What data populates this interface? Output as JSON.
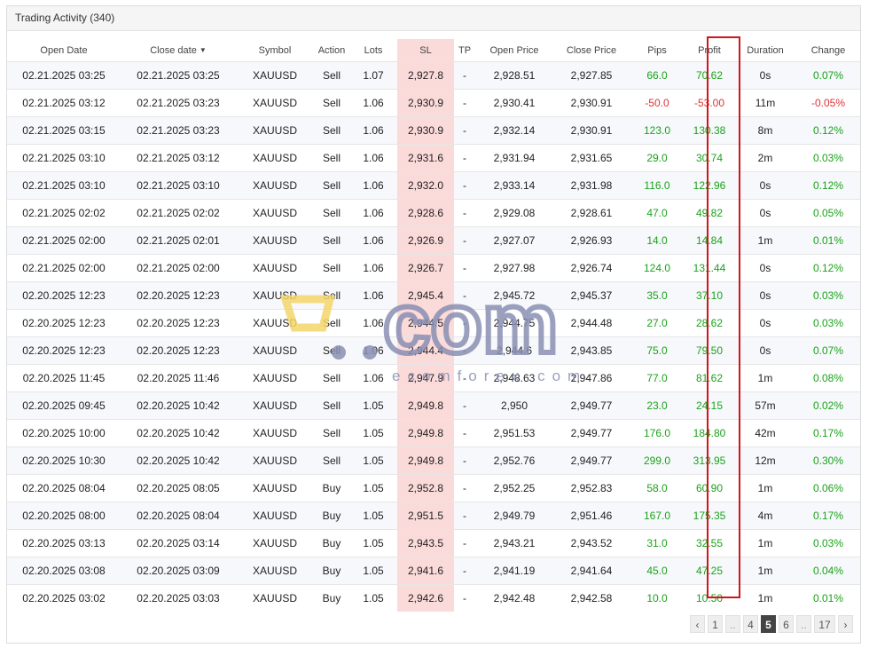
{
  "panel": {
    "title": "Trading Activity (340)"
  },
  "table": {
    "headers": {
      "open_date": "Open Date",
      "close_date": "Close date",
      "symbol": "Symbol",
      "action": "Action",
      "lots": "Lots",
      "sl": "SL",
      "tp": "TP",
      "open_price": "Open Price",
      "close_price": "Close Price",
      "pips": "Pips",
      "profit": "Profit",
      "duration": "Duration",
      "change": "Change"
    },
    "sort_indicator": "▼",
    "rows": [
      {
        "open": "02.21.2025 03:25",
        "close": "02.21.2025 03:25",
        "symbol": "XAUUSD",
        "action": "Sell",
        "lots": "1.07",
        "sl": "2,927.8",
        "tp": "-",
        "open_price": "2,928.51",
        "close_price": "2,927.85",
        "pips": "66.0",
        "profit": "70.62",
        "duration": "0s",
        "change": "0.07%",
        "sign": "pos"
      },
      {
        "open": "02.21.2025 03:12",
        "close": "02.21.2025 03:23",
        "symbol": "XAUUSD",
        "action": "Sell",
        "lots": "1.06",
        "sl": "2,930.9",
        "tp": "-",
        "open_price": "2,930.41",
        "close_price": "2,930.91",
        "pips": "-50.0",
        "profit": "-53.00",
        "duration": "11m",
        "change": "-0.05%",
        "sign": "neg"
      },
      {
        "open": "02.21.2025 03:15",
        "close": "02.21.2025 03:23",
        "symbol": "XAUUSD",
        "action": "Sell",
        "lots": "1.06",
        "sl": "2,930.9",
        "tp": "-",
        "open_price": "2,932.14",
        "close_price": "2,930.91",
        "pips": "123.0",
        "profit": "130.38",
        "duration": "8m",
        "change": "0.12%",
        "sign": "pos"
      },
      {
        "open": "02.21.2025 03:10",
        "close": "02.21.2025 03:12",
        "symbol": "XAUUSD",
        "action": "Sell",
        "lots": "1.06",
        "sl": "2,931.6",
        "tp": "-",
        "open_price": "2,931.94",
        "close_price": "2,931.65",
        "pips": "29.0",
        "profit": "30.74",
        "duration": "2m",
        "change": "0.03%",
        "sign": "pos"
      },
      {
        "open": "02.21.2025 03:10",
        "close": "02.21.2025 03:10",
        "symbol": "XAUUSD",
        "action": "Sell",
        "lots": "1.06",
        "sl": "2,932.0",
        "tp": "-",
        "open_price": "2,933.14",
        "close_price": "2,931.98",
        "pips": "116.0",
        "profit": "122.96",
        "duration": "0s",
        "change": "0.12%",
        "sign": "pos"
      },
      {
        "open": "02.21.2025 02:02",
        "close": "02.21.2025 02:02",
        "symbol": "XAUUSD",
        "action": "Sell",
        "lots": "1.06",
        "sl": "2,928.6",
        "tp": "-",
        "open_price": "2,929.08",
        "close_price": "2,928.61",
        "pips": "47.0",
        "profit": "49.82",
        "duration": "0s",
        "change": "0.05%",
        "sign": "pos"
      },
      {
        "open": "02.21.2025 02:00",
        "close": "02.21.2025 02:01",
        "symbol": "XAUUSD",
        "action": "Sell",
        "lots": "1.06",
        "sl": "2,926.9",
        "tp": "-",
        "open_price": "2,927.07",
        "close_price": "2,926.93",
        "pips": "14.0",
        "profit": "14.84",
        "duration": "1m",
        "change": "0.01%",
        "sign": "pos"
      },
      {
        "open": "02.21.2025 02:00",
        "close": "02.21.2025 02:00",
        "symbol": "XAUUSD",
        "action": "Sell",
        "lots": "1.06",
        "sl": "2,926.7",
        "tp": "-",
        "open_price": "2,927.98",
        "close_price": "2,926.74",
        "pips": "124.0",
        "profit": "131.44",
        "duration": "0s",
        "change": "0.12%",
        "sign": "pos"
      },
      {
        "open": "02.20.2025 12:23",
        "close": "02.20.2025 12:23",
        "symbol": "XAUUSD",
        "action": "Sell",
        "lots": "1.06",
        "sl": "2,945.4",
        "tp": "-",
        "open_price": "2,945.72",
        "close_price": "2,945.37",
        "pips": "35.0",
        "profit": "37.10",
        "duration": "0s",
        "change": "0.03%",
        "sign": "pos"
      },
      {
        "open": "02.20.2025 12:23",
        "close": "02.20.2025 12:23",
        "symbol": "XAUUSD",
        "action": "Sell",
        "lots": "1.06",
        "sl": "2,944.5",
        "tp": "-",
        "open_price": "2,944.75",
        "close_price": "2,944.48",
        "pips": "27.0",
        "profit": "28.62",
        "duration": "0s",
        "change": "0.03%",
        "sign": "pos"
      },
      {
        "open": "02.20.2025 12:23",
        "close": "02.20.2025 12:23",
        "symbol": "XAUUSD",
        "action": "Sell",
        "lots": "1.06",
        "sl": "2,944.4",
        "tp": "-",
        "open_price": "2,944.6",
        "close_price": "2,943.85",
        "pips": "75.0",
        "profit": "79.50",
        "duration": "0s",
        "change": "0.07%",
        "sign": "pos"
      },
      {
        "open": "02.20.2025 11:45",
        "close": "02.20.2025 11:46",
        "symbol": "XAUUSD",
        "action": "Sell",
        "lots": "1.06",
        "sl": "2,947.9",
        "tp": "-",
        "open_price": "2,948.63",
        "close_price": "2,947.86",
        "pips": "77.0",
        "profit": "81.62",
        "duration": "1m",
        "change": "0.08%",
        "sign": "pos"
      },
      {
        "open": "02.20.2025 09:45",
        "close": "02.20.2025 10:42",
        "symbol": "XAUUSD",
        "action": "Sell",
        "lots": "1.05",
        "sl": "2,949.8",
        "tp": "-",
        "open_price": "2,950",
        "close_price": "2,949.77",
        "pips": "23.0",
        "profit": "24.15",
        "duration": "57m",
        "change": "0.02%",
        "sign": "pos"
      },
      {
        "open": "02.20.2025 10:00",
        "close": "02.20.2025 10:42",
        "symbol": "XAUUSD",
        "action": "Sell",
        "lots": "1.05",
        "sl": "2,949.8",
        "tp": "-",
        "open_price": "2,951.53",
        "close_price": "2,949.77",
        "pips": "176.0",
        "profit": "184.80",
        "duration": "42m",
        "change": "0.17%",
        "sign": "pos"
      },
      {
        "open": "02.20.2025 10:30",
        "close": "02.20.2025 10:42",
        "symbol": "XAUUSD",
        "action": "Sell",
        "lots": "1.05",
        "sl": "2,949.8",
        "tp": "-",
        "open_price": "2,952.76",
        "close_price": "2,949.77",
        "pips": "299.0",
        "profit": "313.95",
        "duration": "12m",
        "change": "0.30%",
        "sign": "pos"
      },
      {
        "open": "02.20.2025 08:04",
        "close": "02.20.2025 08:05",
        "symbol": "XAUUSD",
        "action": "Buy",
        "lots": "1.05",
        "sl": "2,952.8",
        "tp": "-",
        "open_price": "2,952.25",
        "close_price": "2,952.83",
        "pips": "58.0",
        "profit": "60.90",
        "duration": "1m",
        "change": "0.06%",
        "sign": "pos"
      },
      {
        "open": "02.20.2025 08:00",
        "close": "02.20.2025 08:04",
        "symbol": "XAUUSD",
        "action": "Buy",
        "lots": "1.05",
        "sl": "2,951.5",
        "tp": "-",
        "open_price": "2,949.79",
        "close_price": "2,951.46",
        "pips": "167.0",
        "profit": "175.35",
        "duration": "4m",
        "change": "0.17%",
        "sign": "pos"
      },
      {
        "open": "02.20.2025 03:13",
        "close": "02.20.2025 03:14",
        "symbol": "XAUUSD",
        "action": "Buy",
        "lots": "1.05",
        "sl": "2,943.5",
        "tp": "-",
        "open_price": "2,943.21",
        "close_price": "2,943.52",
        "pips": "31.0",
        "profit": "32.55",
        "duration": "1m",
        "change": "0.03%",
        "sign": "pos"
      },
      {
        "open": "02.20.2025 03:08",
        "close": "02.20.2025 03:09",
        "symbol": "XAUUSD",
        "action": "Buy",
        "lots": "1.05",
        "sl": "2,941.6",
        "tp": "-",
        "open_price": "2,941.19",
        "close_price": "2,941.64",
        "pips": "45.0",
        "profit": "47.25",
        "duration": "1m",
        "change": "0.04%",
        "sign": "pos"
      },
      {
        "open": "02.20.2025 03:02",
        "close": "02.20.2025 03:03",
        "symbol": "XAUUSD",
        "action": "Buy",
        "lots": "1.05",
        "sl": "2,942.6",
        "tp": "-",
        "open_price": "2,942.48",
        "close_price": "2,942.58",
        "pips": "10.0",
        "profit": "10.50",
        "duration": "1m",
        "change": "0.01%",
        "sign": "pos"
      }
    ]
  },
  "pagination": {
    "prev": "‹",
    "pages": [
      "1",
      "..",
      "4",
      "5",
      "6",
      "..",
      "17"
    ],
    "active": "5",
    "next": "›"
  },
  "watermark": {
    "logo_text": "com",
    "site": "ecomforex.com"
  },
  "colors": {
    "positive": "#1aa31a",
    "negative": "#e03333",
    "sl_highlight": "#fbdada",
    "profit_box": "#d0151c",
    "watermark_yellow": "#f5d66a",
    "watermark_blue": "#8a90b3"
  }
}
